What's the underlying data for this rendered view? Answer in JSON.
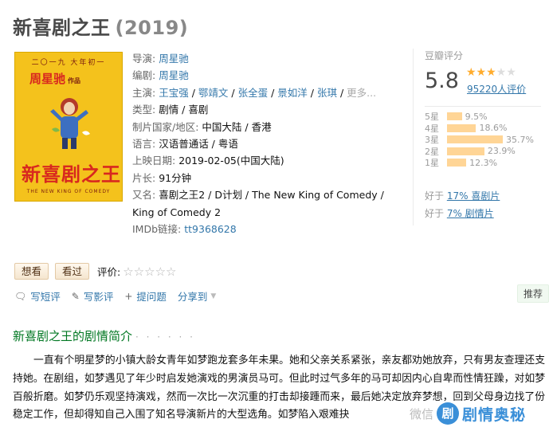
{
  "title": "新喜剧之王",
  "year": "(2019)",
  "poster": {
    "date_line": "二〇一九 大年初一",
    "director_line": "周星驰",
    "director_suffix": "作品",
    "big_title": "新喜剧之王",
    "subtitle": "THE NEW KING OF COMEDY"
  },
  "info": {
    "director_label": "导演:",
    "director": "周星驰",
    "writer_label": "编剧:",
    "writer": "周星驰",
    "cast_label": "主演:",
    "cast": [
      "王宝强",
      "鄂靖文",
      "张全蛋",
      "景如洋",
      "张琪"
    ],
    "cast_more": "更多...",
    "sep": " / ",
    "genre_label": "类型:",
    "genre": "剧情 / 喜剧",
    "country_label": "制片国家/地区:",
    "country": "中国大陆 / 香港",
    "language_label": "语言:",
    "language": "汉语普通话 / 粤语",
    "release_label": "上映日期:",
    "release": "2019-02-05(中国大陆)",
    "runtime_label": "片长:",
    "runtime": "91分钟",
    "aka_label": "又名:",
    "aka": "喜剧之王2 / D计划 / The New King of Comedy / King of Comedy 2",
    "imdb_label": "IMDb链接:",
    "imdb": "tt9368628"
  },
  "rating": {
    "label": "豆瓣评分",
    "score": "5.8",
    "stars_filled": "★★★",
    "stars_empty": "★★",
    "count": "95220人评价",
    "bars": [
      {
        "star": "5星",
        "pct": "9.5%",
        "value": 9.5
      },
      {
        "star": "4星",
        "pct": "18.6%",
        "value": 18.6
      },
      {
        "star": "3星",
        "pct": "35.7%",
        "value": 35.7
      },
      {
        "star": "2星",
        "pct": "23.9%",
        "value": 23.9
      },
      {
        "star": "1星",
        "pct": "12.3%",
        "value": 12.3
      }
    ],
    "better1_prefix": "好于 ",
    "better1_link": "17% 喜剧片",
    "better2_prefix": "好于 ",
    "better2_link": "7% 剧情片"
  },
  "buttons": {
    "want": "想看",
    "seen": "看过",
    "rate_label": "评价:",
    "empty_stars": "☆☆☆☆☆"
  },
  "actions": {
    "short_review": "写短评",
    "review": "写影评",
    "ask": "提问题",
    "share": "分享到"
  },
  "recommend": "推荐",
  "section": {
    "title": "新喜剧之王的剧情简介",
    "dots": "· · · · · ·"
  },
  "summary": "一直有个明星梦的小镇大龄女青年如梦跑龙套多年未果。她和父亲关系紧张，亲友都劝她放弃，只有男友查理还支持她。在剧组，如梦遇见了年少时启发她演戏的男演员马可。但此时过气多年的马可却因内心自卑而性情狂躁，对如梦百般折磨。如梦仍乐观坚持演戏，然而一次比一次沉重的打击却接踵而来，最后她决定放弃梦想，回到父母身边找了份稳定工作，但却得知自己入围了知名导演新片的大型选角。如梦陷入艰难抉",
  "watermark": {
    "wx": "微信",
    "logo": "剧",
    "name": "剧情奥秘"
  }
}
